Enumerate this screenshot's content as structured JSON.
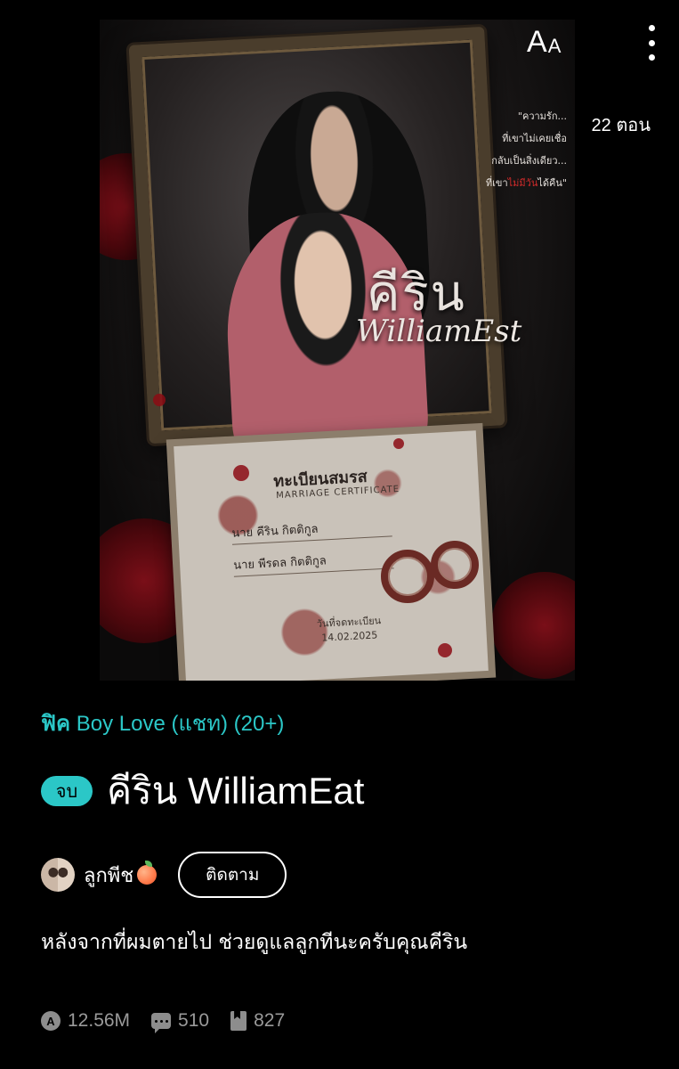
{
  "toolbar": {
    "font_size_label_big": "A",
    "font_size_label_small": "A",
    "more_icon": "more-vertical-icon"
  },
  "cover": {
    "quote_line1": "\"ความรัก...",
    "quote_line2": "ที่เขาไม่เคยเชื่อ",
    "quote_line3": "กลับเป็นสิ่งเดียว...",
    "quote_line4_a": "ที่เขา",
    "quote_line4_red": "ไม่มีวัน",
    "quote_line4_b": "ได้คืน\"",
    "title_th": "คีริน",
    "title_en": "WilliamEst",
    "certificate_title": "ทะเบียนสมรส",
    "certificate_subtitle": "MARRIAGE CERTIFICATE",
    "certificate_line1": "นาย  คีริน     กิตติกูล",
    "certificate_line2": "นาย  พีรดล    กิตติกูล",
    "certificate_date_label": "วันที่จดทะเบียน",
    "certificate_date": "14.02.2025",
    "accent_blood": "#8c0c14"
  },
  "episodes": "22 ตอน",
  "genre": {
    "prefix": "ฟิค",
    "category": "Boy Love (แชท) (20+)",
    "color": "#2bc7c7"
  },
  "story": {
    "status_badge": "จบ",
    "title": "คีริน WilliamEat"
  },
  "author": {
    "name": "ลูกพีช",
    "emoji_icon": "peach-icon",
    "follow_label": "ติดตาม"
  },
  "synopsis": "หลังจากที่ผมตายไป ช่วยดูแลลูกทีนะครับคุณคีริน",
  "stats": {
    "views": "12.56M",
    "comments": "510",
    "bookmarks": "827"
  }
}
